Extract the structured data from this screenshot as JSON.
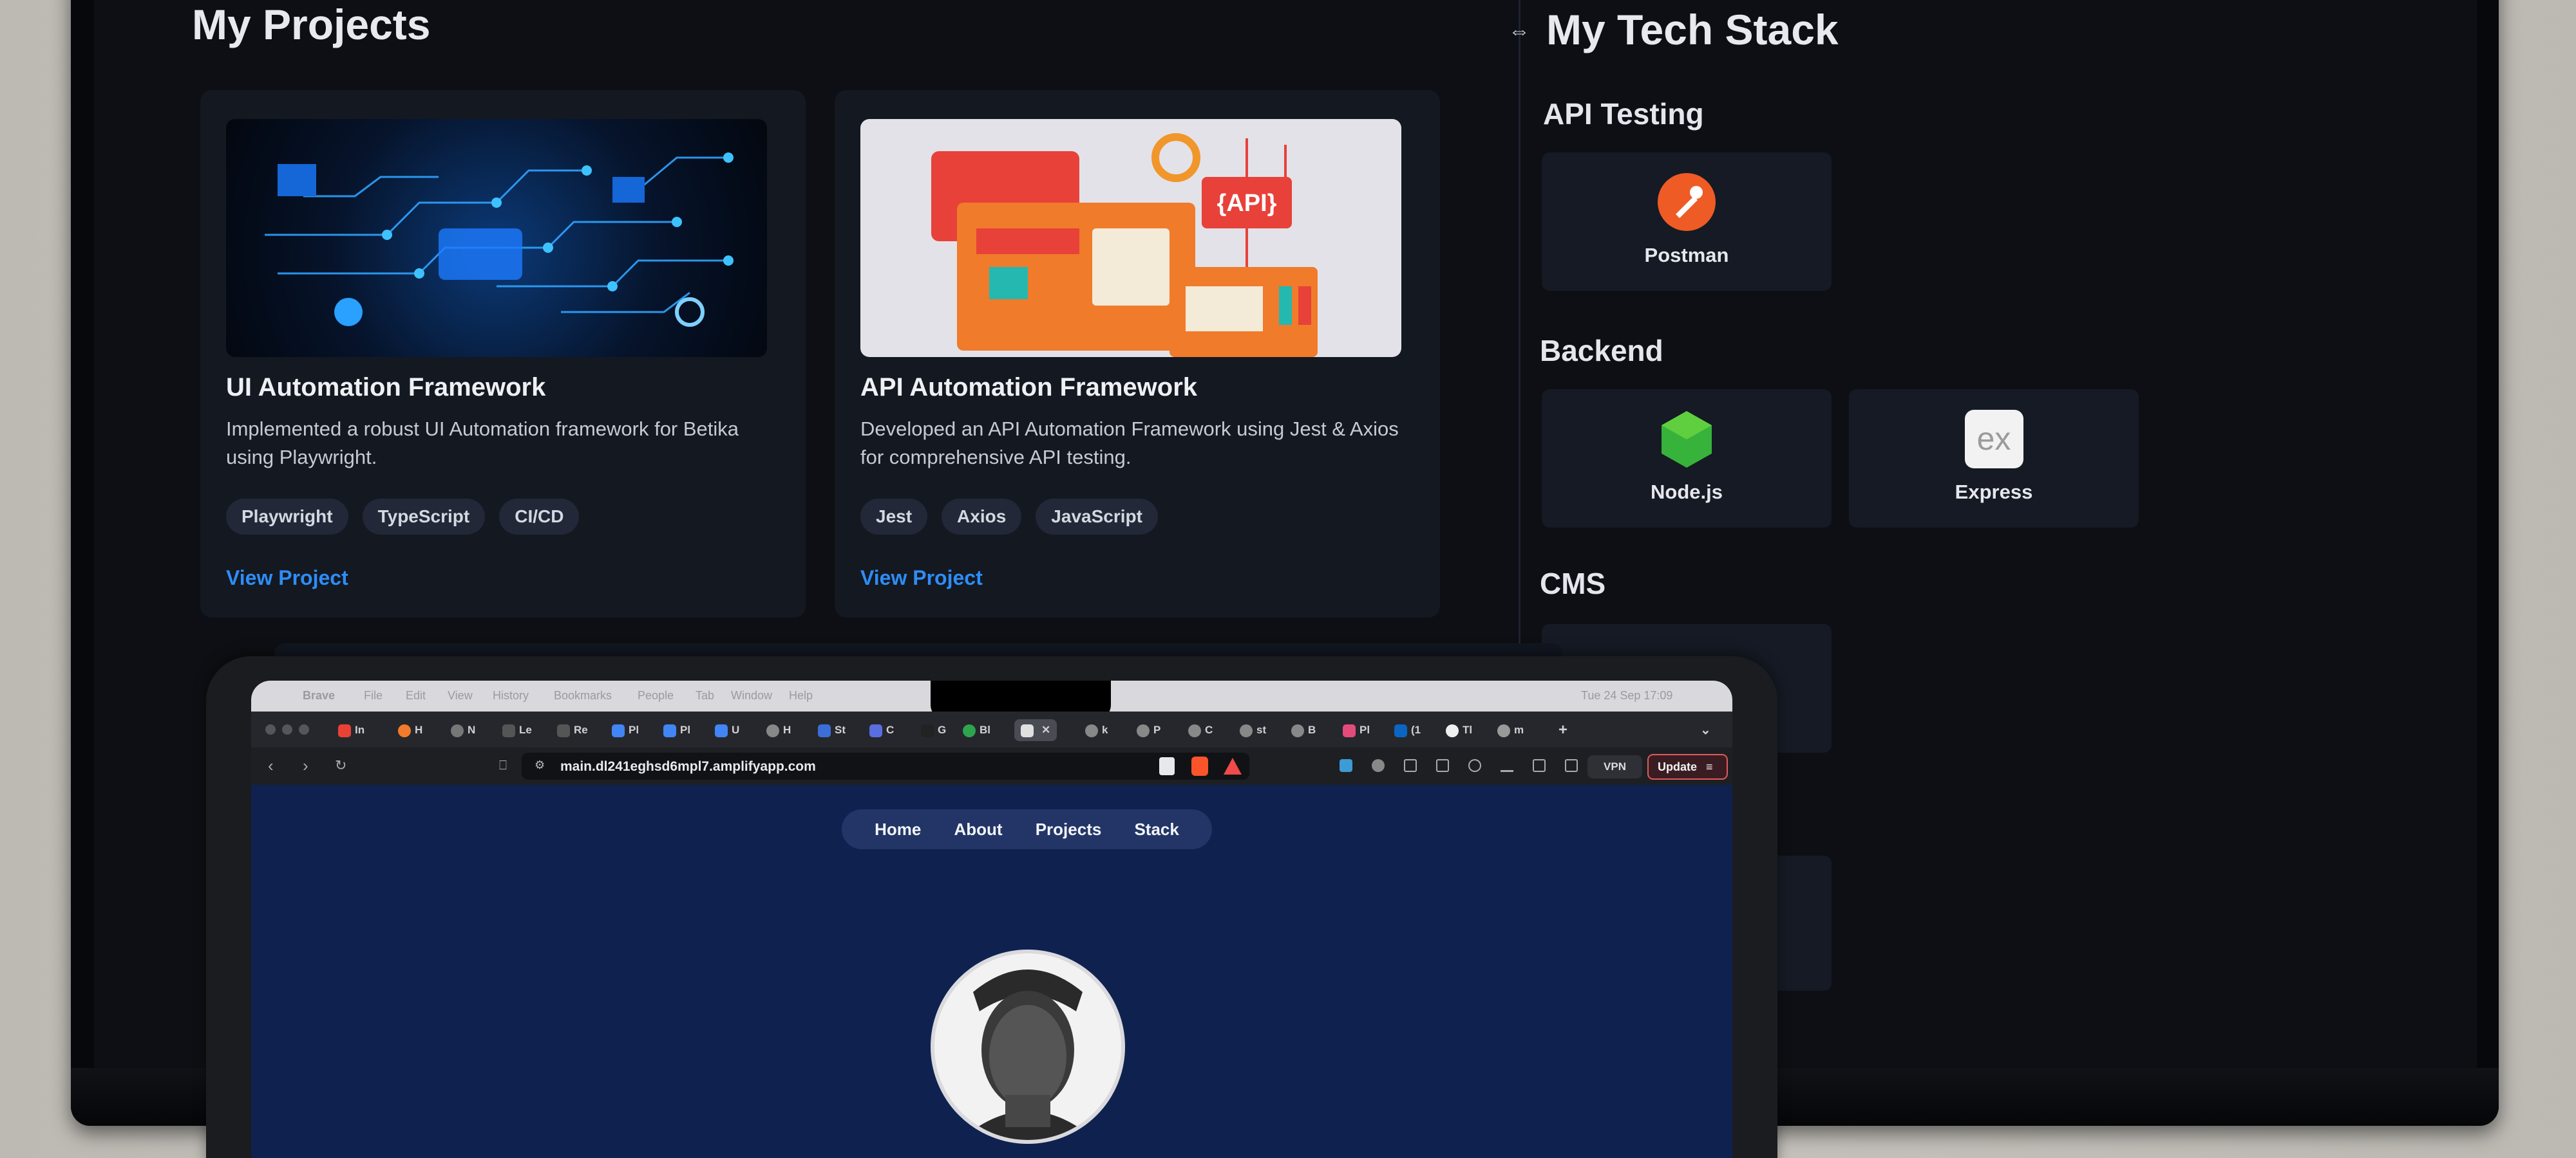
{
  "monitor": {
    "projects_title": "My Projects",
    "stack_title": "My Tech Stack",
    "projects": [
      {
        "title": "UI Automation Framework",
        "description": "Implemented a robust UI Automation framework for Betika using Playwright.",
        "tags": [
          "Playwright",
          "TypeScript",
          "CI/CD"
        ],
        "link": "View Project"
      },
      {
        "title": "API Automation Framework",
        "description": "Developed an API Automation Framework using Jest & Axios for comprehensive API testing.",
        "tags": [
          "Jest",
          "Axios",
          "JavaScript"
        ],
        "link": "View Project",
        "thumb_label": "{API}"
      }
    ],
    "stack": {
      "api_testing": {
        "heading": "API Testing",
        "items": [
          "Postman"
        ]
      },
      "backend": {
        "heading": "Backend",
        "items": [
          "Node.js",
          "Express"
        ]
      },
      "cms": {
        "heading": "CMS"
      }
    }
  },
  "laptop": {
    "menubar": [
      "Brave",
      "File",
      "Edit",
      "View",
      "History",
      "Bookmarks",
      "People",
      "Tab",
      "Window",
      "Help"
    ],
    "clock": "Tue 24 Sep 17:09",
    "tabs": [
      "In",
      "H",
      "N",
      "Le",
      "Re",
      "Pl",
      "Pl",
      "U",
      "H",
      "St",
      "C",
      "G",
      "Bl",
      "",
      "k",
      "P",
      "C",
      "st",
      "B",
      "Pl",
      "(1",
      "Tl",
      "m"
    ],
    "url": "main.dl241eghsd6mpl7.amplifyapp.com",
    "vpn": "VPN",
    "update": "Update",
    "nav": [
      "Home",
      "About",
      "Projects",
      "Stack"
    ]
  },
  "colors": {
    "accent_link": "#2d8df6",
    "page_bg": "#0f214f",
    "card_bg": "#141821"
  }
}
